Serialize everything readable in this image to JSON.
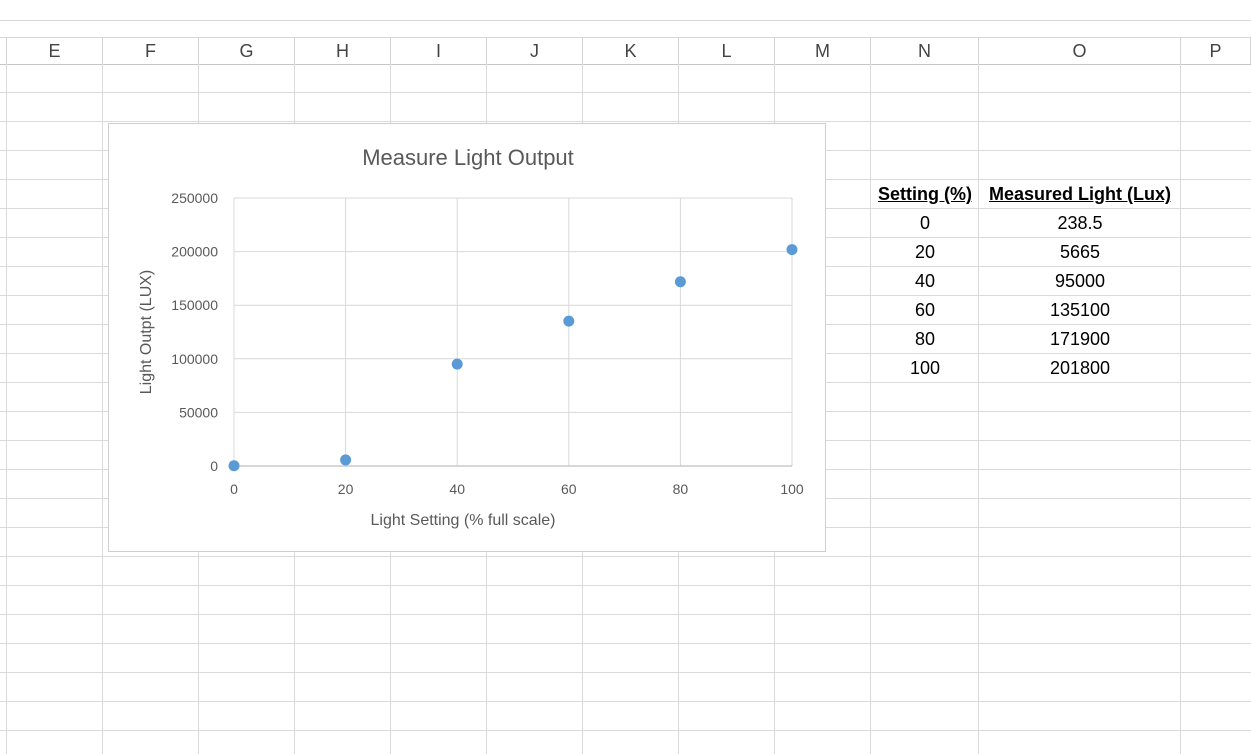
{
  "columns": [
    "E",
    "F",
    "G",
    "H",
    "I",
    "J",
    "K",
    "L",
    "M",
    "N",
    "O",
    "P"
  ],
  "table": {
    "headers": [
      "Setting (%)",
      "Measured Light (Lux)"
    ],
    "rows": [
      [
        "0",
        "238.5"
      ],
      [
        "20",
        "5665"
      ],
      [
        "40",
        "95000"
      ],
      [
        "60",
        "135100"
      ],
      [
        "80",
        "171900"
      ],
      [
        "100",
        "201800"
      ]
    ]
  },
  "chart_data": {
    "type": "scatter",
    "title": "Measure Light Output",
    "xlabel": "Light Setting (% full scale)",
    "ylabel": "Light Outpt (LUX)",
    "xlim": [
      0,
      100
    ],
    "ylim": [
      0,
      250000
    ],
    "x_ticks": [
      "0",
      "20",
      "40",
      "60",
      "80",
      "100"
    ],
    "y_ticks": [
      "0",
      "50000",
      "100000",
      "150000",
      "200000",
      "250000"
    ],
    "grid": true,
    "legend": "none",
    "marker_color": "#5b9bd5",
    "series": [
      {
        "x": [
          0,
          20,
          40,
          60,
          80,
          100
        ],
        "y": [
          238.5,
          5665,
          95000,
          135100,
          171900,
          201800
        ]
      }
    ]
  }
}
